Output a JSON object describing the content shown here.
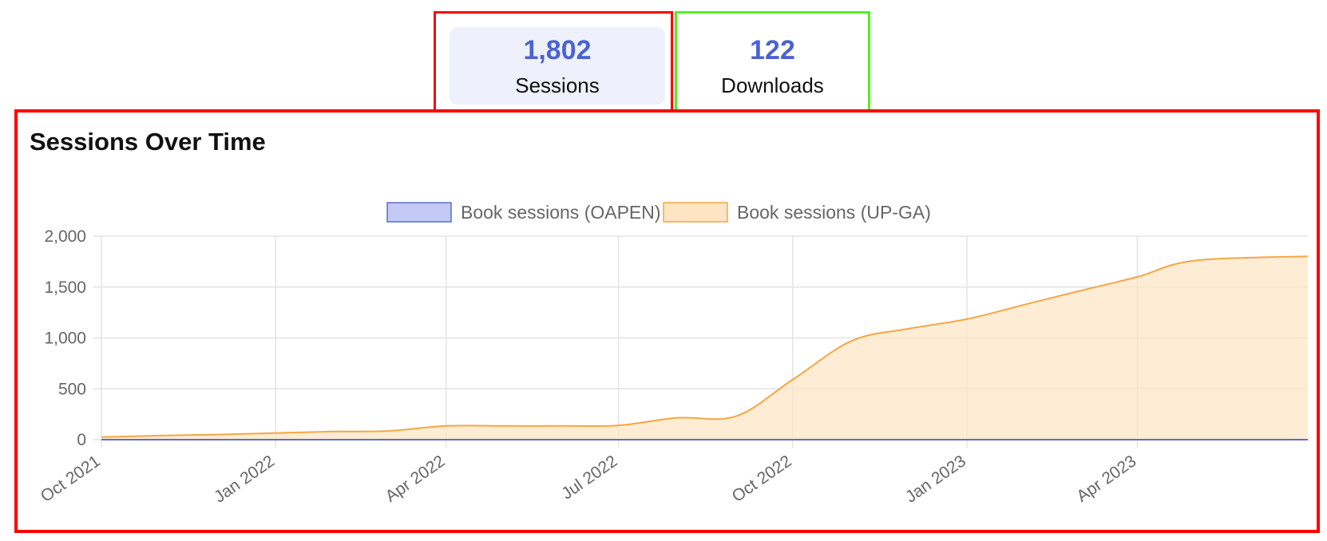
{
  "tabs": [
    {
      "value": "1,802",
      "label": "Sessions",
      "active": true
    },
    {
      "value": "122",
      "label": "Downloads",
      "active": false
    }
  ],
  "colors": {
    "accent": "#4b63cf",
    "oapen_line": "#5b6fd0",
    "oapen_fill": "#c2c9f2",
    "upga_line": "#f5a742",
    "upga_fill": "#fde4c3",
    "frame_red": "#ff0000",
    "frame_green": "#55ee22"
  },
  "chart_data": {
    "type": "area",
    "title": "Sessions Over Time",
    "x_axis_type": "time",
    "x_ticks": [
      "Oct 2021",
      "Jan 2022",
      "Apr 2022",
      "Jul 2022",
      "Oct 2022",
      "Jan 2023",
      "Apr 2023"
    ],
    "y_ticks": [
      "0",
      "500",
      "1,000",
      "1,500",
      "2,000"
    ],
    "ylim": [
      0,
      2000
    ],
    "xlim": [
      "2021-10-01",
      "2023-06-30"
    ],
    "grid": true,
    "legend": "top-center",
    "series": [
      {
        "name": "Book sessions (OAPEN)",
        "points": [
          [
            "2021-10-01",
            0
          ],
          [
            "2023-06-30",
            0
          ]
        ]
      },
      {
        "name": "Book sessions (UP-GA)",
        "points": [
          [
            "2021-10-01",
            25
          ],
          [
            "2021-11-01",
            40
          ],
          [
            "2021-12-01",
            50
          ],
          [
            "2022-01-01",
            65
          ],
          [
            "2022-02-01",
            80
          ],
          [
            "2022-03-01",
            85
          ],
          [
            "2022-04-01",
            135
          ],
          [
            "2022-05-01",
            135
          ],
          [
            "2022-06-01",
            135
          ],
          [
            "2022-07-01",
            140
          ],
          [
            "2022-08-01",
            215
          ],
          [
            "2022-09-01",
            230
          ],
          [
            "2022-10-01",
            590
          ],
          [
            "2022-11-01",
            970
          ],
          [
            "2022-12-01",
            1090
          ],
          [
            "2023-01-01",
            1185
          ],
          [
            "2023-02-01",
            1330
          ],
          [
            "2023-03-01",
            1460
          ],
          [
            "2023-04-01",
            1600
          ],
          [
            "2023-05-01",
            1760
          ],
          [
            "2023-06-30",
            1802
          ]
        ]
      }
    ]
  }
}
